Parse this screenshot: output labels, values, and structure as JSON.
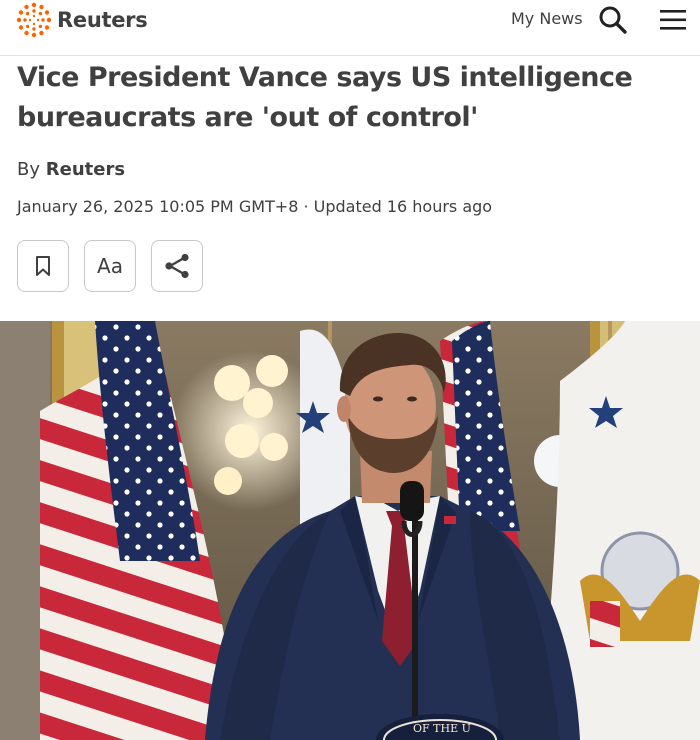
{
  "header": {
    "brand": "Reuters",
    "my_news_label": "My News",
    "search_icon": "search-icon",
    "menu_icon": "hamburger-menu-icon",
    "brand_color": "#fa6400"
  },
  "article": {
    "headline": "Vice President Vance says US intelligence bureaucrats are 'out of control'",
    "byline_prefix": "By",
    "byline_author": "Reuters",
    "dateline": "January 26, 2025 10:05 PM GMT+8 · Updated 16 hours ago"
  },
  "tools": {
    "bookmark_icon": "bookmark-icon",
    "text_size_label": "Aa",
    "share_icon": "share-icon"
  },
  "photo": {
    "seal_text": "OF THE U"
  }
}
